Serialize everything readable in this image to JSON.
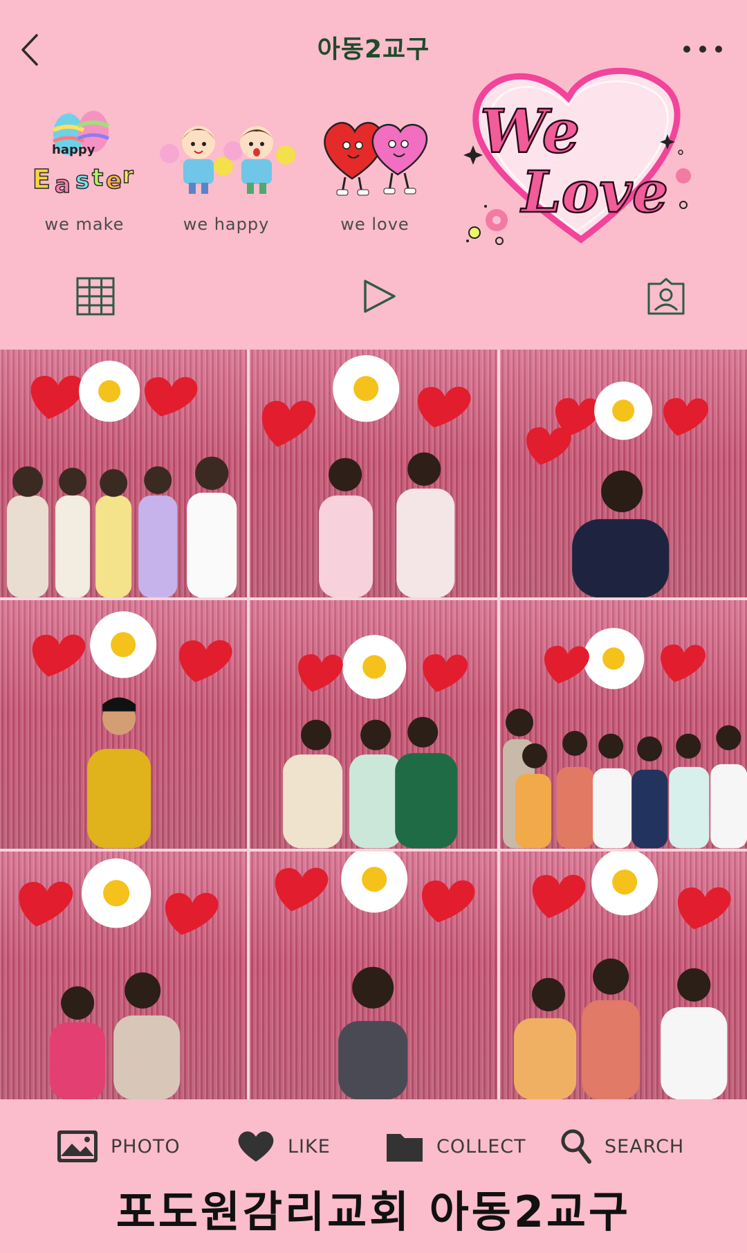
{
  "header": {
    "title": "아동2교구",
    "back_icon": "chevron-left-icon",
    "more_icon": "more-horizontal-icon"
  },
  "highlights": [
    {
      "label": "we make",
      "icon": "easter-eggs-sticker",
      "sticker_text": [
        "happy",
        "Easter"
      ]
    },
    {
      "label": "we happy",
      "icon": "cheering-kids-sticker"
    },
    {
      "label": "we love",
      "icon": "two-hearts-sticker"
    }
  ],
  "logo": {
    "text_line1": "We",
    "text_line2": "Love"
  },
  "tabs": [
    {
      "name": "grid",
      "icon": "grid-icon"
    },
    {
      "name": "reels",
      "icon": "play-icon"
    },
    {
      "name": "tagged",
      "icon": "tagged-person-icon"
    }
  ],
  "photos": [
    {
      "id": "photo-1",
      "description_hidden": true
    },
    {
      "id": "photo-2"
    },
    {
      "id": "photo-3"
    },
    {
      "id": "photo-4"
    },
    {
      "id": "photo-5"
    },
    {
      "id": "photo-6"
    },
    {
      "id": "photo-7"
    },
    {
      "id": "photo-8"
    },
    {
      "id": "photo-9"
    }
  ],
  "bottom_nav": {
    "photo_label": "PHOTO",
    "like_label": "LIKE",
    "collect_label": "COLLECT",
    "search_label": "SEARCH"
  },
  "footer": {
    "title": "포도원감리교회 아동2교구"
  },
  "colors": {
    "background": "#fbbccb",
    "title": "#1f4a2c",
    "accent_pink": "#f15c99"
  }
}
